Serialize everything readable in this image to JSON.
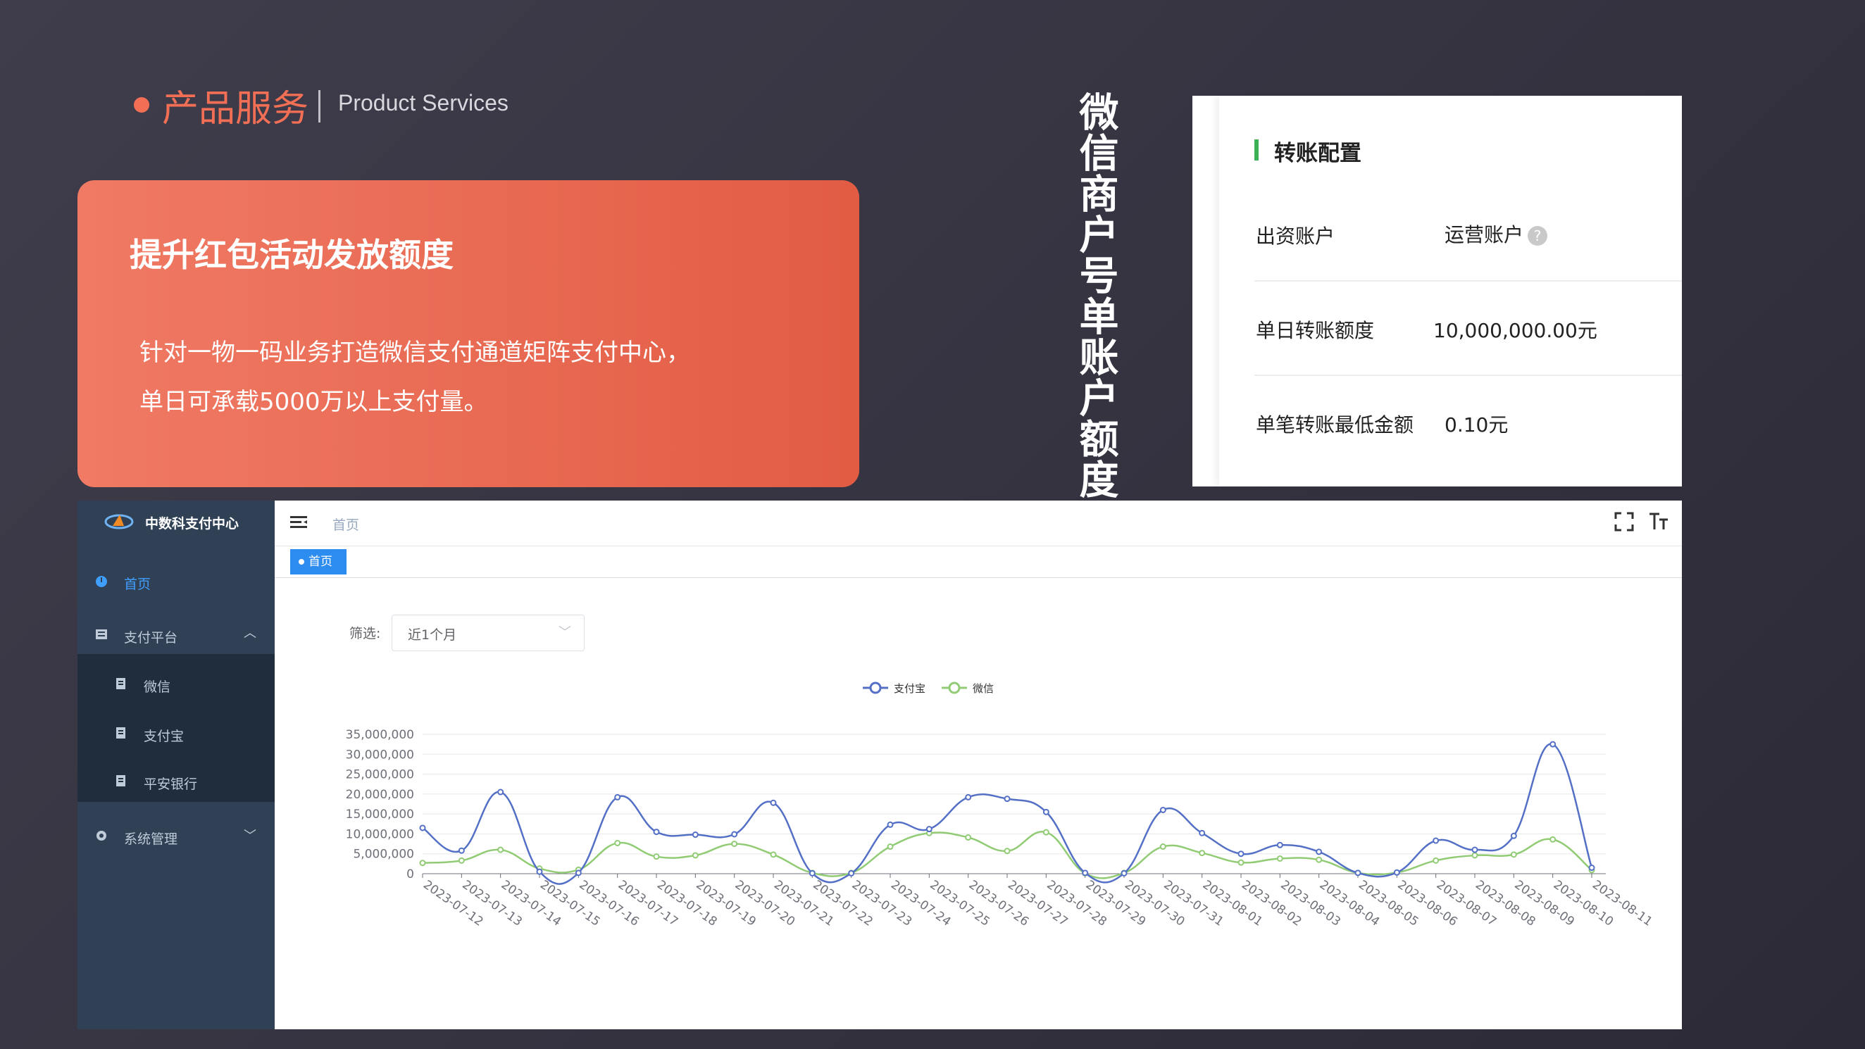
{
  "header": {
    "title_cn": "产品服务",
    "title_en": "Product Services"
  },
  "card": {
    "title": "提升红包活动发放额度",
    "desc": "针对一物一码业务打造微信支付通道矩阵支付中心，\n单日可承载5000万以上支付量。"
  },
  "vertical_title": "微信商户号单账户额度",
  "transfer_config": {
    "heading": "转账配置",
    "rows": [
      {
        "label": "出资账户",
        "value": "运营账户"
      },
      {
        "label": "单日转账额度",
        "value": "10,000,000.00元"
      },
      {
        "label": "单笔转账最低金额",
        "value": "0.10元"
      }
    ]
  },
  "dashboard": {
    "brand": "中数科支付中心",
    "breadcrumb": "首页",
    "tag": "首页",
    "filter_label": "筛选:",
    "filter_value": "近1个月",
    "sidebar": {
      "home": "首页",
      "pay_platform": "支付平台",
      "sub": [
        "微信",
        "支付宝",
        "平安银行"
      ],
      "sys": "系统管理"
    },
    "colors": {
      "sidebar": "#304156",
      "submenu": "#1f2d3d",
      "accent": "#409eff",
      "tag": "#2d8cf0"
    }
  },
  "chart_data": {
    "type": "line",
    "x": [
      "2023-07-12",
      "2023-07-13",
      "2023-07-14",
      "2023-07-15",
      "2023-07-16",
      "2023-07-17",
      "2023-07-18",
      "2023-07-19",
      "2023-07-20",
      "2023-07-21",
      "2023-07-22",
      "2023-07-23",
      "2023-07-24",
      "2023-07-25",
      "2023-07-26",
      "2023-07-27",
      "2023-07-28",
      "2023-07-29",
      "2023-07-30",
      "2023-07-31",
      "2023-08-01",
      "2023-08-02",
      "2023-08-03",
      "2023-08-04",
      "2023-08-05",
      "2023-08-06",
      "2023-08-07",
      "2023-08-08",
      "2023-08-09",
      "2023-08-10",
      "2023-08-11"
    ],
    "series": [
      {
        "name": "支付宝",
        "color": "#5470c6",
        "values": [
          11500000,
          5800000,
          20500000,
          500000,
          200000,
          19200000,
          10500000,
          9800000,
          9900000,
          17800000,
          100000,
          100000,
          12300000,
          11200000,
          19200000,
          18800000,
          15500000,
          200000,
          100000,
          16000000,
          10200000,
          5000000,
          7200000,
          5500000,
          200000,
          300000,
          8300000,
          6000000,
          9500000,
          32500000,
          1500000
        ]
      },
      {
        "name": "微信",
        "color": "#91cc75",
        "values": [
          2700000,
          3300000,
          6000000,
          1300000,
          1000000,
          7700000,
          4300000,
          4600000,
          7500000,
          4800000,
          200000,
          200000,
          6800000,
          10200000,
          9100000,
          5700000,
          10400000,
          100000,
          200000,
          6800000,
          5200000,
          2800000,
          3800000,
          3500000,
          200000,
          300000,
          3300000,
          4600000,
          4800000,
          8600000,
          900000
        ]
      }
    ],
    "yticks": [
      "0",
      "5,000,000",
      "10,000,000",
      "15,000,000",
      "20,000,000",
      "25,000,000",
      "30,000,000",
      "35,000,000"
    ],
    "ylim": [
      0,
      35000000
    ],
    "legend": "top-center"
  }
}
